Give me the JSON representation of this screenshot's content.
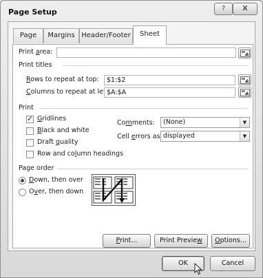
{
  "window": {
    "title": "Page Setup",
    "help_glyph": "?",
    "close_glyph": "X"
  },
  "tabs": [
    {
      "label": "Page",
      "active": false
    },
    {
      "label": "Margins",
      "active": false
    },
    {
      "label": "Header/Footer",
      "active": false
    },
    {
      "label": "Sheet",
      "active": true
    }
  ],
  "print_area": {
    "label_pre": "Print ",
    "label_key": "a",
    "label_post": "rea:",
    "value": ""
  },
  "print_titles": {
    "heading": "Print titles",
    "rows": {
      "label_key": "R",
      "label_post": "ows to repeat at top:",
      "value": "$1:$2"
    },
    "cols": {
      "label_key": "C",
      "label_post": "olumns to repeat at left:",
      "value": "$A:$A"
    }
  },
  "print": {
    "heading": "Print",
    "gridlines": {
      "label_key": "G",
      "label_post": "ridlines",
      "checked": true
    },
    "black_white": {
      "label_key": "B",
      "label_post": "lack and white",
      "checked": false
    },
    "draft": {
      "label_pre": "Draft ",
      "label_key": "q",
      "label_post": "uality",
      "checked": false
    },
    "row_col_headings": {
      "label_pre": "Row and co",
      "label_key": "l",
      "label_post": "umn headings",
      "checked": false
    },
    "comments": {
      "label_pre": "Co",
      "label_key": "m",
      "label_post": "ments:",
      "value": "(None)"
    },
    "cell_errors": {
      "label_pre": "Cell ",
      "label_key": "e",
      "label_post": "rrors as:",
      "value": "displayed"
    }
  },
  "page_order": {
    "heading": "Page order",
    "down_over": {
      "label_key": "D",
      "label_post": "own, then over",
      "selected": true
    },
    "over_down": {
      "label_pre": "O",
      "label_key": "v",
      "label_post": "er, then down",
      "selected": false
    }
  },
  "buttons": {
    "print": {
      "label_key": "P",
      "label_post": "rint..."
    },
    "print_preview": {
      "label_pre": "Print Previe",
      "label_key": "w",
      "label_post": ""
    },
    "options": {
      "label_key": "O",
      "label_post": "ptions..."
    },
    "ok": "OK",
    "cancel": "Cancel"
  },
  "icons": {
    "collapse": "collapse-dialog-icon",
    "page_order_preview": "page-order-diagram-icon",
    "cursor": "mouse-pointer-icon"
  }
}
